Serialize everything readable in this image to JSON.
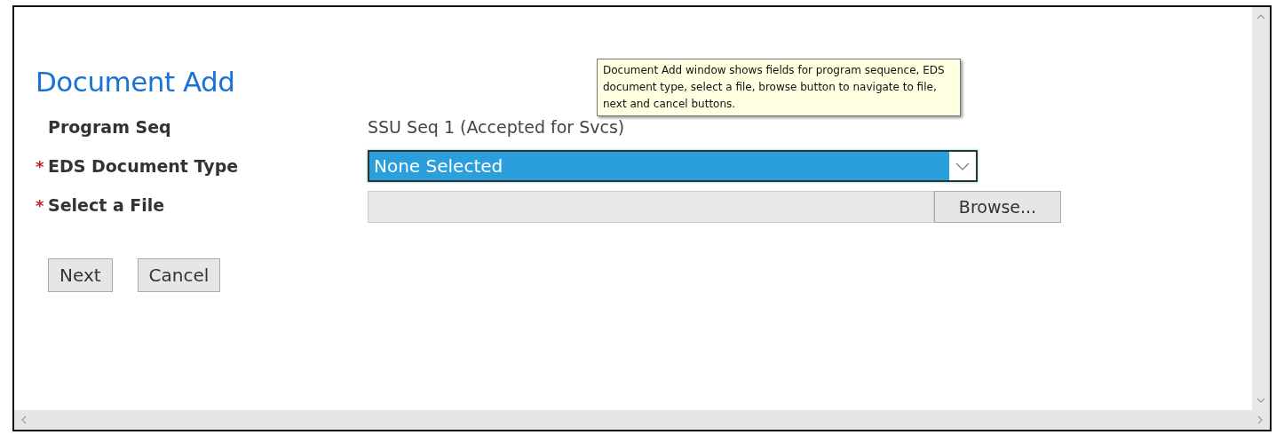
{
  "title": "Document Add",
  "tooltip": {
    "text": "Document Add window shows fields for program sequence, EDS document type, select a file, browse button to navigate to file, next and cancel buttons."
  },
  "fields": [
    {
      "kind": "text",
      "label": "Program Seq",
      "value": "SSU Seq 1 (Accepted for Svcs)"
    },
    {
      "kind": "select",
      "required_mark": "*",
      "label": "EDS Document Type",
      "value": "None Selected",
      "focused": true
    },
    {
      "kind": "file",
      "required_mark": "*",
      "label": "Select a File",
      "button": "Browse..."
    }
  ],
  "buttons": [
    "Next",
    "Cancel"
  ]
}
